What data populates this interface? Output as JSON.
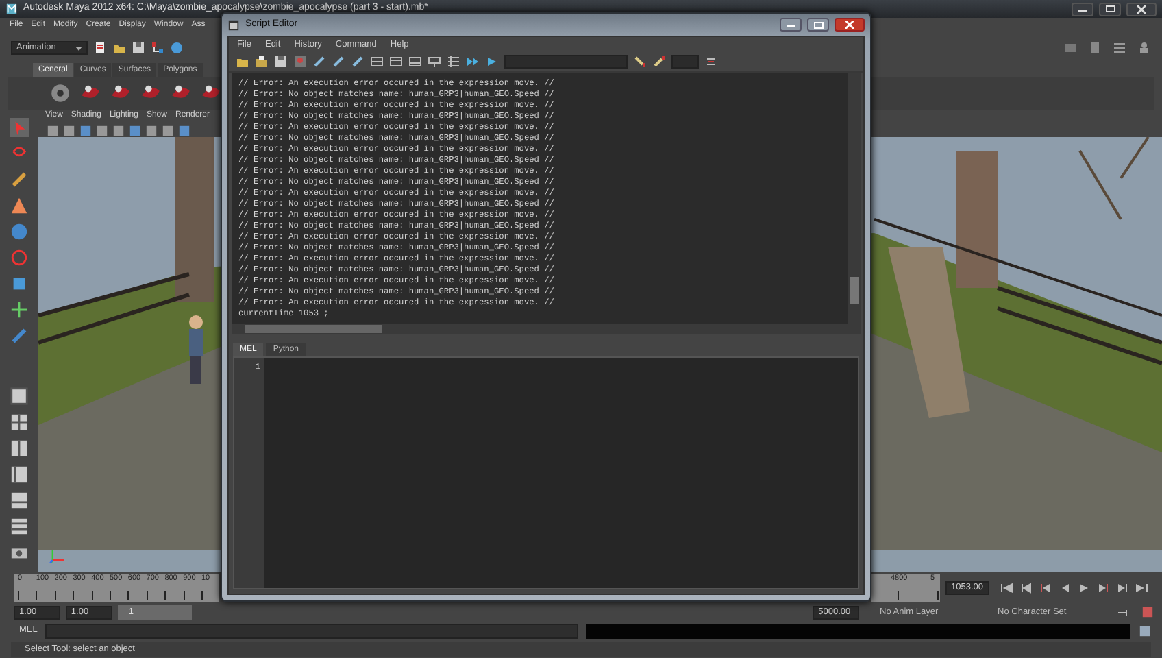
{
  "main_window": {
    "title": "Autodesk Maya 2012 x64: C:\\Maya\\zombie_apocalypse\\zombie_apocalypse (part 3 - start).mb*",
    "menu": [
      "File",
      "Edit",
      "Modify",
      "Create",
      "Display",
      "Window",
      "Ass"
    ],
    "mode_dropdown": {
      "value": "Animation"
    },
    "shelf_tabs": [
      {
        "label": "General",
        "selected": true
      },
      {
        "label": "Curves",
        "selected": false
      },
      {
        "label": "Surfaces",
        "selected": false
      },
      {
        "label": "Polygons",
        "selected": false
      }
    ],
    "viewport_menu": [
      "View",
      "Shading",
      "Lighting",
      "Show",
      "Renderer"
    ],
    "time_slider": {
      "left_ticks": [
        "0",
        "100",
        "200",
        "300",
        "400",
        "500",
        "600",
        "700",
        "800",
        "900",
        "10"
      ],
      "right_ticks": [
        "4800",
        "5"
      ]
    },
    "current_time": "1053.00",
    "range": {
      "start": "1.00",
      "playback_start": "1.00",
      "slider_value": "1",
      "end": "5000.00"
    },
    "anim_layer": "No Anim Layer",
    "character_set": "No Character Set",
    "command_line": {
      "label": "MEL"
    },
    "help_line": "Select Tool: select an object"
  },
  "script_editor": {
    "title": "Script Editor",
    "menu": [
      "File",
      "Edit",
      "History",
      "Command",
      "Help"
    ],
    "log": [
      "// Error: An execution error occured in the expression move. //",
      "// Error: No object matches name: human_GRP3|human_GEO.Speed //",
      "// Error: An execution error occured in the expression move. //",
      "// Error: No object matches name: human_GRP3|human_GEO.Speed //",
      "// Error: An execution error occured in the expression move. //",
      "// Error: No object matches name: human_GRP3|human_GEO.Speed //",
      "// Error: An execution error occured in the expression move. //",
      "// Error: No object matches name: human_GRP3|human_GEO.Speed //",
      "// Error: An execution error occured in the expression move. //",
      "// Error: No object matches name: human_GRP3|human_GEO.Speed //",
      "// Error: An execution error occured in the expression move. //",
      "// Error: No object matches name: human_GRP3|human_GEO.Speed //",
      "// Error: An execution error occured in the expression move. //",
      "// Error: No object matches name: human_GRP3|human_GEO.Speed //",
      "// Error: An execution error occured in the expression move. //",
      "// Error: No object matches name: human_GRP3|human_GEO.Speed //",
      "// Error: An execution error occured in the expression move. //",
      "// Error: No object matches name: human_GRP3|human_GEO.Speed //",
      "// Error: An execution error occured in the expression move. //",
      "// Error: No object matches name: human_GRP3|human_GEO.Speed //",
      "// Error: An execution error occured in the expression move. //",
      "currentTime 1053 ;"
    ],
    "tabs": [
      {
        "label": "MEL",
        "selected": true
      },
      {
        "label": "Python",
        "selected": false
      }
    ],
    "line_numbers": [
      "1"
    ]
  }
}
